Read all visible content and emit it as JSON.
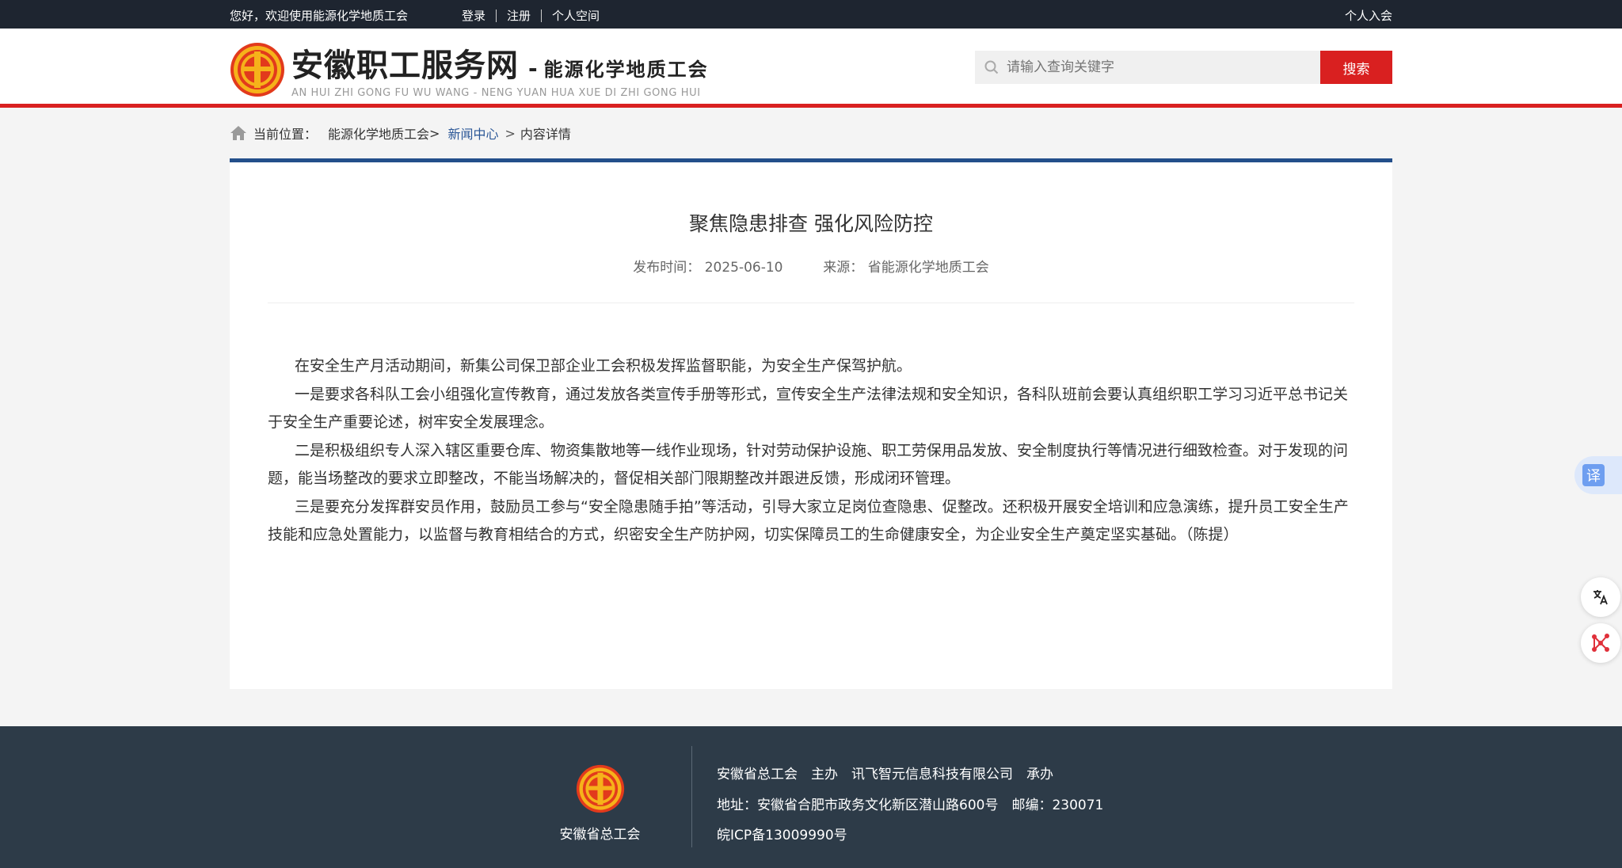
{
  "topbar": {
    "welcome": "您好，欢迎使用能源化学地质工会",
    "login": "登录",
    "register": "注册",
    "personal_space": "个人空间",
    "join": "个人入会"
  },
  "header": {
    "logo_title": "安徽职工服务网",
    "logo_dash": "-",
    "logo_subtitle": "能源化学地质工会",
    "logo_pinyin": "AN HUI ZHI GONG FU WU WANG - NENG YUAN HUA XUE DI ZHI GONG HUI",
    "search_placeholder": "请输入查询关键字",
    "search_button": "搜索"
  },
  "breadcrumb": {
    "label": "当前位置：",
    "items": [
      "能源化学地质工会",
      "新闻中心",
      "内容详情"
    ],
    "separator": ">"
  },
  "article": {
    "title": "聚焦隐患排查 强化风险防控",
    "publish_label": "发布时间：",
    "publish_date": "2025-06-10",
    "source_label": "来源：",
    "source": "省能源化学地质工会",
    "paragraphs": [
      "在安全生产月活动期间，新集公司保卫部企业工会积极发挥监督职能，为安全生产保驾护航。",
      "一是要求各科队工会小组强化宣传教育，通过发放各类宣传手册等形式，宣传安全生产法律法规和安全知识，各科队班前会要认真组织职工学习习近平总书记关于安全生产重要论述，树牢安全发展理念。",
      "二是积极组织专人深入辖区重要仓库、物资集散地等一线作业现场，针对劳动保护设施、职工劳保用品发放、安全制度执行等情况进行细致检查。对于发现的问题，能当场整改的要求立即整改，不能当场解决的，督促相关部门限期整改并跟进反馈，形成闭环管理。",
      "三是要充分发挥群安员作用，鼓励员工参与“安全隐患随手拍”等活动，引导大家立足岗位查隐患、促整改。还积极开展安全培训和应急演练，提升员工安全生产技能和应急处置能力，以监督与教育相结合的方式，织密安全生产防护网，切实保障员工的生命健康安全，为企业安全生产奠定坚实基础。（陈提）"
    ]
  },
  "footer": {
    "org_name": "安徽省总工会",
    "line1": "安徽省总工会　主办　讯飞智元信息科技有限公司　承办",
    "line2": "地址：安徽省合肥市政务文化新区潜山路600号　邮编：230071",
    "line3": "皖ICP备13009990号"
  },
  "widgets": {
    "translate_label": "译"
  },
  "colors": {
    "brand_red": "#d92020",
    "nav_blue": "#234f8a",
    "topbar_bg": "#1e2530",
    "footer_bg": "#2d3b48"
  }
}
